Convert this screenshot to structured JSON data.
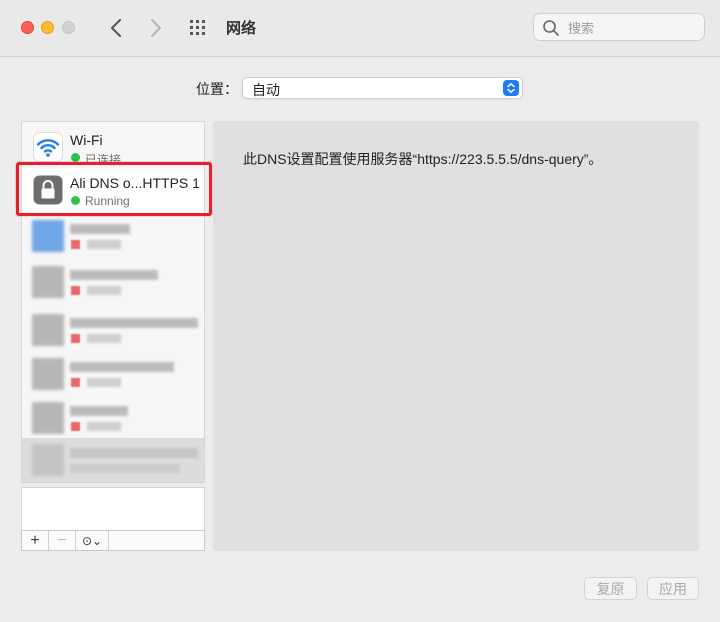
{
  "window": {
    "title": "网络",
    "search_placeholder": "搜索"
  },
  "location": {
    "label": "位置：",
    "value": "自动"
  },
  "services": [
    {
      "name": "Wi-Fi",
      "status": "已连接",
      "icon": "wifi-icon",
      "status_color": "#2ec24a"
    },
    {
      "name": "Ali DNS o...HTTPS 1",
      "status": "Running",
      "icon": "lock-icon",
      "status_color": "#2ec24a",
      "selected": true
    }
  ],
  "sidebar_toolbar": {
    "add": "+",
    "remove": "−",
    "more": "⊙⌄"
  },
  "detail": {
    "description": "此DNS设置配置使用服务器“https://223.5.5.5/dns-query”。"
  },
  "buttons": {
    "revert": "复原",
    "apply": "应用"
  },
  "colors": {
    "accent": "#1f7cf0",
    "highlight": "#e5202a",
    "connected": "#2ec24a"
  }
}
